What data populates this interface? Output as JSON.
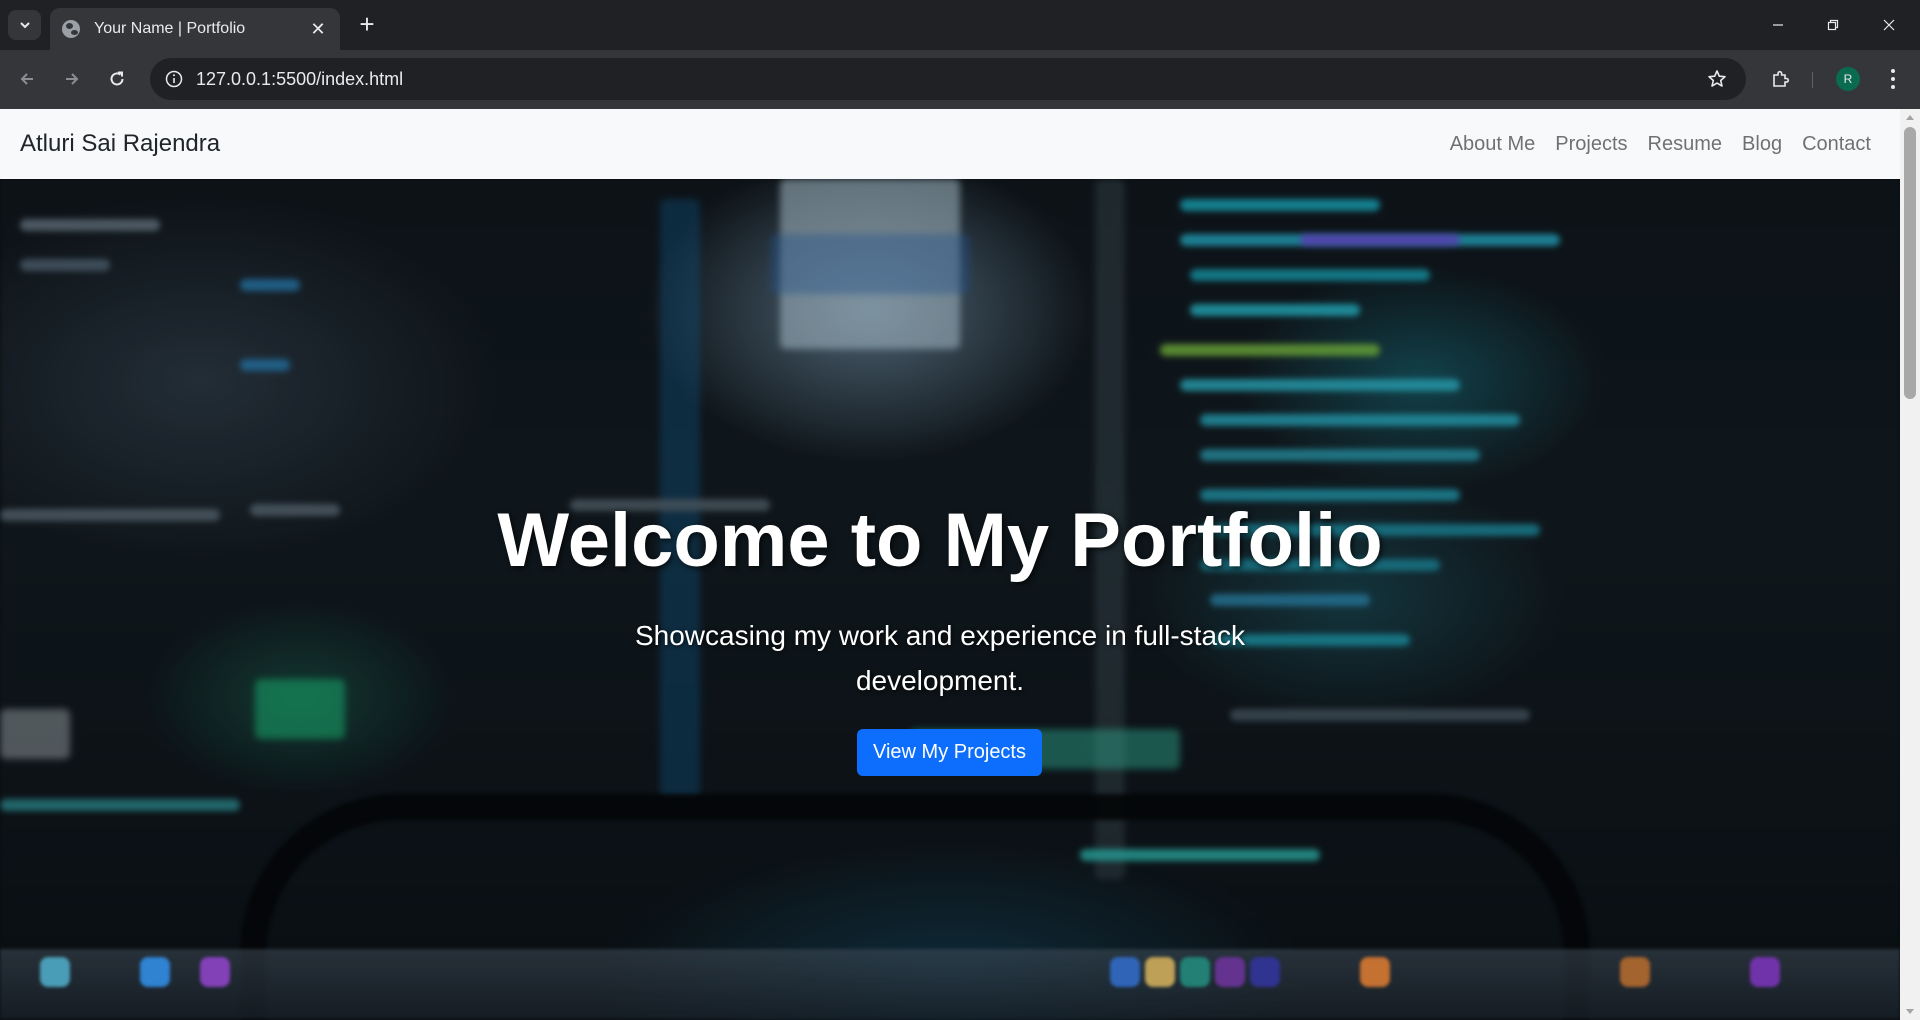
{
  "browser": {
    "tab_title": "Your Name | Portfolio",
    "url": "127.0.0.1:5500/index.html",
    "profile_initial": "R"
  },
  "site": {
    "brand": "Atluri Sai Rajendra",
    "nav": [
      "About Me",
      "Projects",
      "Resume",
      "Blog",
      "Contact"
    ]
  },
  "hero": {
    "title": "Welcome to My Portfolio",
    "subtitle": "Showcasing my work and experience in full-stack development.",
    "button_label": "View My Projects"
  },
  "colors": {
    "primary_button": "#0d6efd",
    "navbar_bg": "#f8f9fa",
    "chrome_dark": "#202124",
    "chrome_toolbar": "#35363a"
  }
}
